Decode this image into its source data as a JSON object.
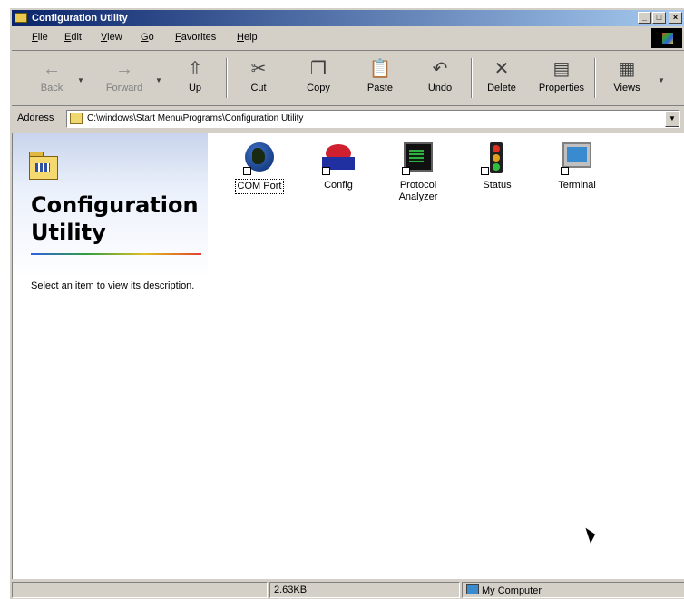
{
  "window": {
    "title": "Configuration Utility"
  },
  "menu": {
    "items": [
      "File",
      "Edit",
      "View",
      "Go",
      "Favorites",
      "Help"
    ]
  },
  "toolbar": {
    "buttons": [
      {
        "label": "Back",
        "icon": "back-arrow-icon",
        "glyph": "←",
        "enabled": false
      },
      {
        "label": "Forward",
        "icon": "forward-arrow-icon",
        "glyph": "→",
        "enabled": false
      },
      {
        "label": "Up",
        "icon": "up-folder-icon",
        "glyph": "⇧",
        "enabled": true
      },
      {
        "label": "Cut",
        "icon": "scissors-icon",
        "glyph": "✂",
        "enabled": true
      },
      {
        "label": "Copy",
        "icon": "copy-icon",
        "glyph": "❐",
        "enabled": true
      },
      {
        "label": "Paste",
        "icon": "paste-icon",
        "glyph": "📋",
        "enabled": true
      },
      {
        "label": "Undo",
        "icon": "undo-icon",
        "glyph": "↶",
        "enabled": true
      },
      {
        "label": "Delete",
        "icon": "delete-x-icon",
        "glyph": "✕",
        "enabled": true
      },
      {
        "label": "Properties",
        "icon": "properties-icon",
        "glyph": "▤",
        "enabled": true
      },
      {
        "label": "Views",
        "icon": "views-icon",
        "glyph": "▦",
        "enabled": true
      }
    ]
  },
  "address": {
    "label": "Address",
    "value": "C:\\windows\\Start Menu\\Programs\\Configuration Utility"
  },
  "sidebar": {
    "title": "Configuration Utility",
    "description": "Select an item to view its description."
  },
  "items": [
    {
      "label": "COM Port",
      "icon": "globe-icon",
      "selected": true
    },
    {
      "label": "Config",
      "icon": "config-icon",
      "selected": false
    },
    {
      "label": "Protocol Analyzer",
      "icon": "monitor-icon",
      "selected": false
    },
    {
      "label": "Status",
      "icon": "traffic-light-icon",
      "selected": false
    },
    {
      "label": "Terminal",
      "icon": "terminal-icon",
      "selected": false
    }
  ],
  "status": {
    "size": "2.63KB",
    "zone": "My Computer"
  },
  "colors": {
    "titlebar": "#0a246a",
    "chrome": "#d4d0c8"
  }
}
